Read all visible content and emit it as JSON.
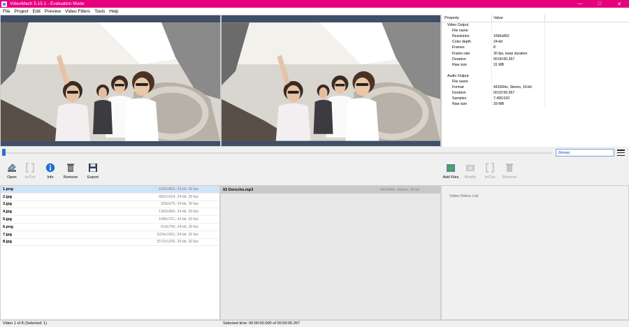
{
  "window": {
    "title": "VideoMach 5.15.1 - Evaluation Mode",
    "buttons": [
      "—",
      "□",
      "✕"
    ]
  },
  "menu": [
    "File",
    "Project",
    "Edit",
    "Preview",
    "Video Filters",
    "Tools",
    "Help"
  ],
  "properties": {
    "headers": [
      "Property",
      "Value"
    ],
    "rows": [
      {
        "key": "Video Output",
        "value": "",
        "indent": 1
      },
      {
        "key": "File name",
        "value": "",
        "indent": 2
      },
      {
        "key": "Resolution",
        "value": "1566x852",
        "indent": 2
      },
      {
        "key": "Color depth",
        "value": "24-bit",
        "indent": 2
      },
      {
        "key": "Frames",
        "value": "8",
        "indent": 2
      },
      {
        "key": "Frame rate",
        "value": "30 fps, keep duration",
        "indent": 2
      },
      {
        "key": "Duration",
        "value": "00:00:00.267",
        "indent": 2
      },
      {
        "key": "Raw size",
        "value": "31 MB",
        "indent": 2
      },
      {
        "key": "",
        "value": "",
        "indent": 1
      },
      {
        "key": "Audio Output",
        "value": "",
        "indent": 1
      },
      {
        "key": "File name",
        "value": "",
        "indent": 2
      },
      {
        "key": "Format",
        "value": "44100Hz, Stereo, 16-bit",
        "indent": 2
      },
      {
        "key": "Duration",
        "value": "00:02:50.057",
        "indent": 2
      },
      {
        "key": "Samples",
        "value": "7,499,520",
        "indent": 2
      },
      {
        "key": "Raw size",
        "value": "29 MB",
        "indent": 2
      }
    ]
  },
  "seek": {
    "time": "0msec",
    "position": 0.0
  },
  "toolbar_left": [
    {
      "label": "Open",
      "icon": "open-icon",
      "disabled": false
    },
    {
      "label": "In/Out",
      "icon": "in-out-icon",
      "disabled": true
    },
    {
      "label": "Info",
      "icon": "info-icon",
      "disabled": false
    },
    {
      "label": "Remove",
      "icon": "trash-icon",
      "disabled": false
    },
    {
      "label": "Export",
      "icon": "save-icon",
      "disabled": false
    }
  ],
  "toolbar_right": [
    {
      "label": "Add Files",
      "icon": "add-files-icon",
      "disabled": false
    },
    {
      "label": "Modify",
      "icon": "modify-icon",
      "disabled": true
    },
    {
      "label": "In/Out",
      "icon": "in-out-icon",
      "disabled": true
    },
    {
      "label": "Remove",
      "icon": "trash-icon",
      "disabled": true
    }
  ],
  "video_files": [
    {
      "name": "1.png",
      "info": "1566x852, 24-bit, 30 fps"
    },
    {
      "name": "2.jpg",
      "info": "683x1024, 24-bit, 30 fps"
    },
    {
      "name": "3.jpg",
      "info": "928x675, 24-bit, 30 fps"
    },
    {
      "name": "4.jpg",
      "info": "1300x866, 24-bit, 30 fps"
    },
    {
      "name": "5.jpg",
      "info": "1086x721, 24-bit, 30 fps"
    },
    {
      "name": "6.png",
      "info": "619x700, 24-bit, 30 fps"
    },
    {
      "name": "7.jpg",
      "info": "1024x1001, 24-bit, 30 fps"
    },
    {
      "name": "8.jpg",
      "info": "1572x1200, 24-bit, 30 fps"
    }
  ],
  "audio_files": [
    {
      "name": "02 Derecho.mp3",
      "info": "44100Hz, Stereo, 16-bit"
    }
  ],
  "video_filters_label": "Video Filters List",
  "status": {
    "left": "Video 1 of 8  (Selected: 1)",
    "right": "Selected time:  00:00:00.000  of  00:00:00.267"
  }
}
